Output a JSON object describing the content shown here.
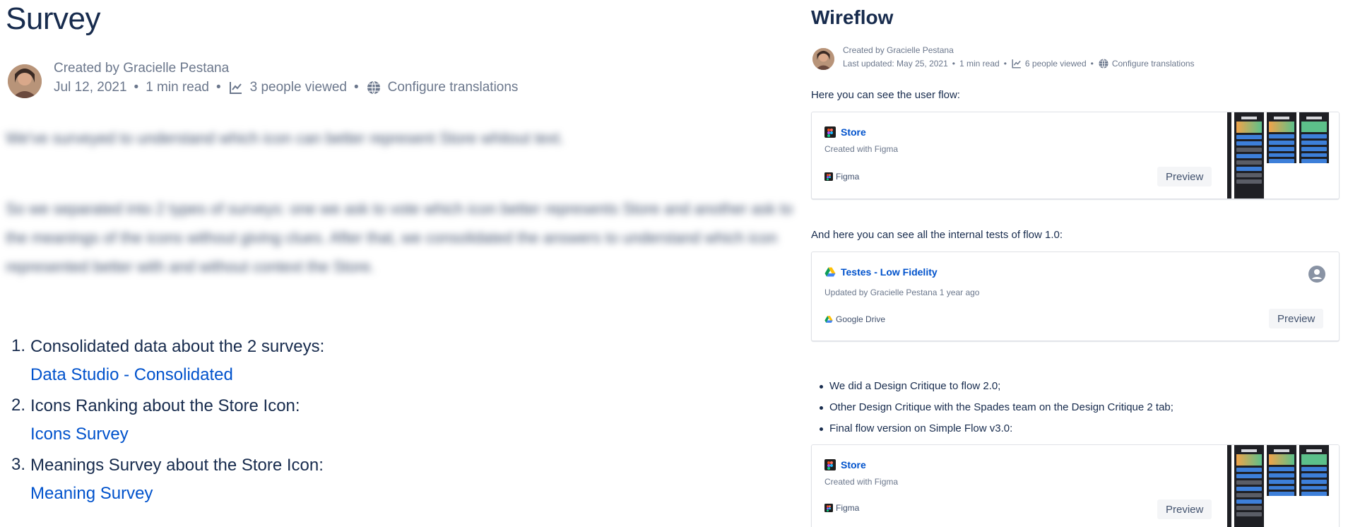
{
  "left": {
    "title": "Survey",
    "byline": "Created by Gracielle Pestana",
    "date": "Jul 12, 2021",
    "read_time": "1 min read",
    "views": "3 people viewed",
    "translations": "Configure translations",
    "blurred_p1": "We've surveyed to understand which icon can better represent Store whitout text.",
    "blurred_p2": "So we separated into 2 types of surveys: one we ask to vote which icon better represents Store and another ask to the meanings of the icons without giving clues. After that, we consolidated the answers to understand which icon represented better with and without context the Store.",
    "list": [
      {
        "num": "1.",
        "text": "Consolidated data about the 2 surveys:",
        "link": "Data Studio - Consolidated"
      },
      {
        "num": "2.",
        "text": "Icons Ranking about the Store Icon:",
        "link": "Icons Survey"
      },
      {
        "num": "3.",
        "text": "Meanings Survey about the Store Icon:",
        "link": "Meaning Survey"
      }
    ]
  },
  "right": {
    "title": "Wireflow",
    "byline": "Created by Gracielle Pestana",
    "last_updated": "Last updated: May 25, 2021",
    "read_time": "1 min read",
    "views": "6 people viewed",
    "translations": "Configure translations",
    "intro": "Here you can see the user flow:",
    "intro2": "And here you can see all the internal tests of flow 1.0:",
    "card1": {
      "title": "Store",
      "sub": "Created with Figma",
      "source": "Figma",
      "preview": "Preview"
    },
    "card2": {
      "title": "Testes - Low Fidelity",
      "sub": "Updated by Gracielle Pestana 1 year ago",
      "source": "Google Drive",
      "preview": "Preview"
    },
    "card3": {
      "title": "Store",
      "sub": "Created with Figma",
      "source": "Figma",
      "preview": "Preview"
    },
    "bullets": [
      "We did a Design Critique to flow 2.0;",
      "Other Design Critique with the Spades team on the Design Critique 2 tab;",
      "Final flow version on Simple Flow v3.0:"
    ]
  },
  "colors": {
    "link": "#0052cc",
    "text": "#172b4d",
    "muted": "#6b778c"
  }
}
